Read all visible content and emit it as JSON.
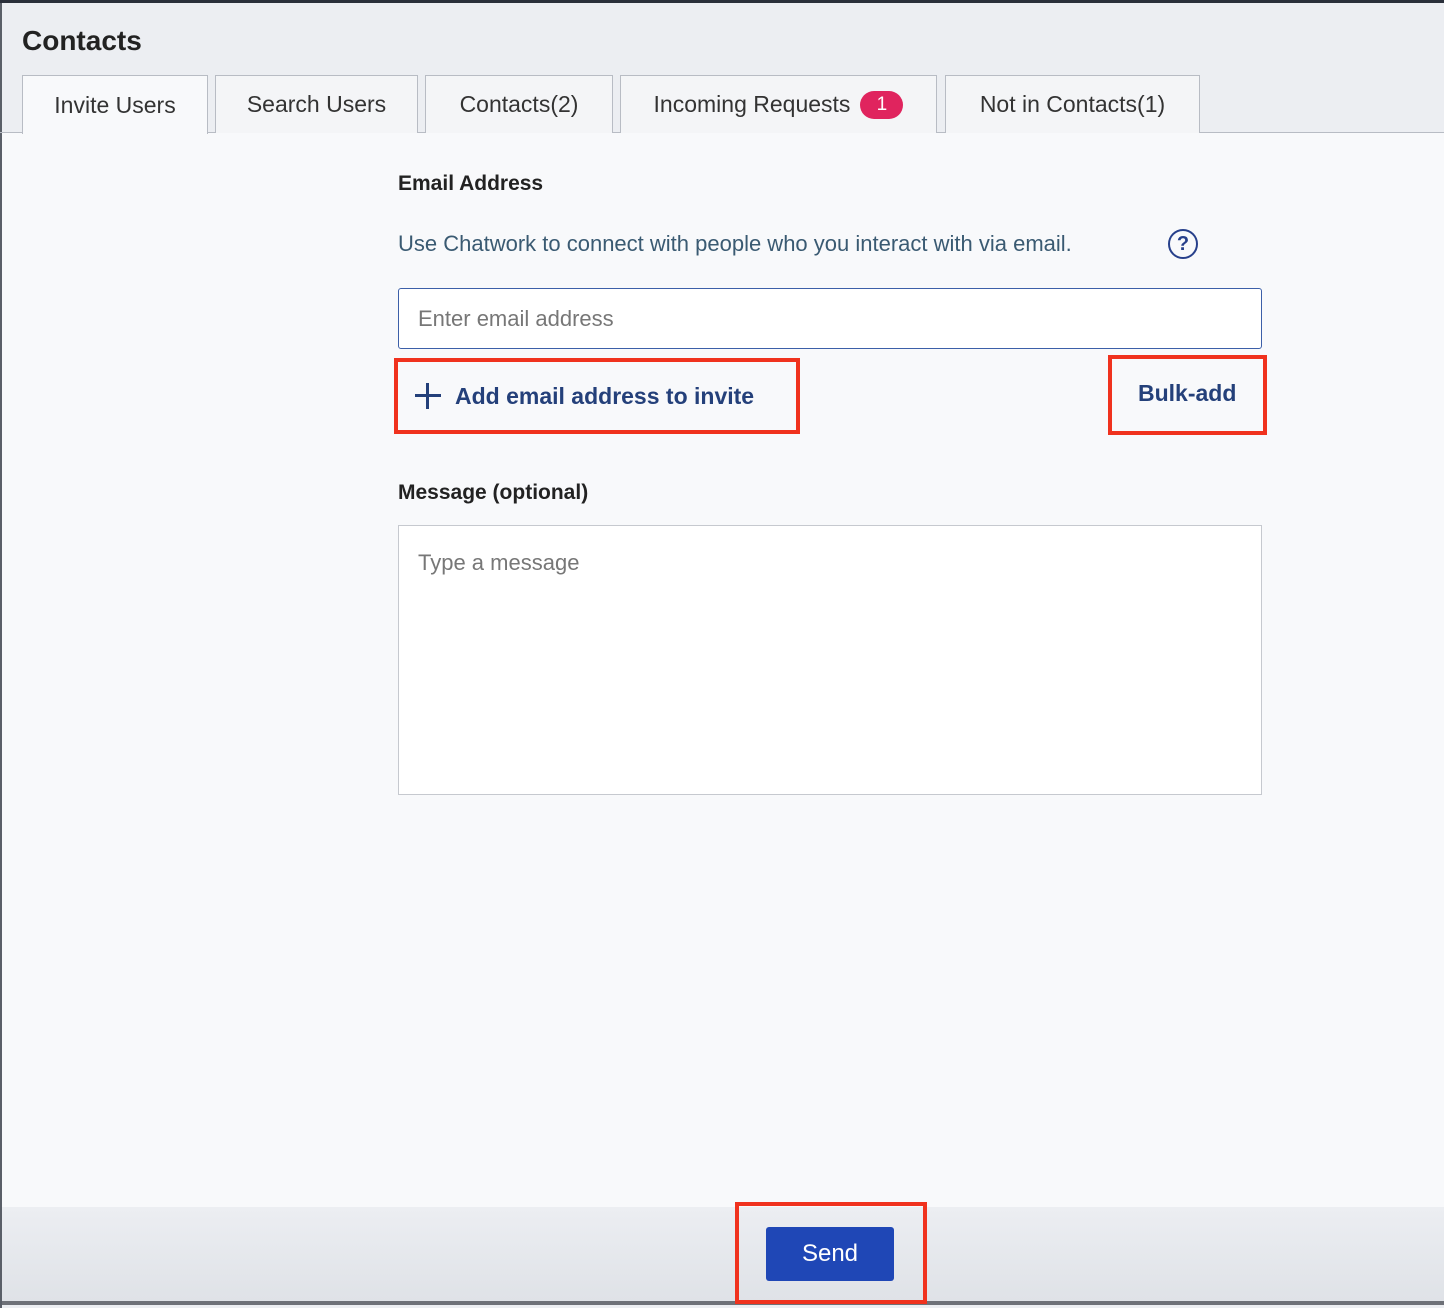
{
  "header": {
    "title": "Contacts"
  },
  "tabs": [
    {
      "label": "Invite Users",
      "active": true
    },
    {
      "label": "Search Users"
    },
    {
      "label": "Contacts(2)"
    },
    {
      "label": "Incoming Requests",
      "badge": "1"
    },
    {
      "label": "Not in Contacts(1)"
    }
  ],
  "form": {
    "email_label": "Email Address",
    "help_text": "Use Chatwork to connect with people who you interact with via email.",
    "help_icon": "?",
    "email_placeholder": "Enter email address",
    "email_value": "",
    "add_link_label": "Add email address to invite",
    "bulk_add_label": "Bulk-add",
    "message_label": "Message (optional)",
    "message_placeholder": "Type a message",
    "message_value": ""
  },
  "footer": {
    "send_label": "Send"
  },
  "colors": {
    "accent": "#24407a",
    "primary_button": "#1f47b6",
    "badge": "#e0245e",
    "highlight": "#f0321e"
  }
}
